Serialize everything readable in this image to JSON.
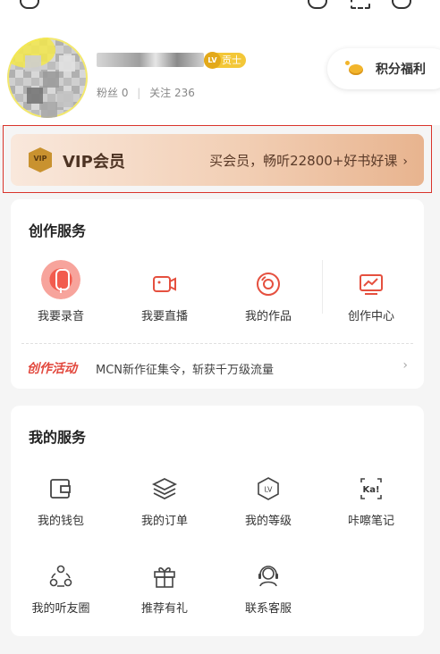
{
  "profile": {
    "level_badge_icon": "LV",
    "level_badge_text": "贡士",
    "fans_label": "粉丝 0",
    "stats_sep": "|",
    "follow_label": "关注 236",
    "points_button": "积分福利"
  },
  "vip": {
    "icon_text": "VIP",
    "title": "VIP会员",
    "promo": "买会员，畅听22800+好书好课",
    "arrow": "›"
  },
  "creation": {
    "title": "创作服务",
    "items": [
      {
        "label": "我要录音",
        "icon": "microphone-icon"
      },
      {
        "label": "我要直播",
        "icon": "video-camera-icon"
      },
      {
        "label": "我的作品",
        "icon": "disc-icon"
      },
      {
        "label": "创作中心",
        "icon": "chart-monitor-icon"
      }
    ],
    "activity_tag": "创作活动",
    "activity_text": "MCN新作征集令，斩获千万级流量",
    "activity_arrow": "›"
  },
  "my_services": {
    "title": "我的服务",
    "items": [
      {
        "label": "我的钱包",
        "icon": "wallet-icon"
      },
      {
        "label": "我的订单",
        "icon": "layers-icon"
      },
      {
        "label": "我的等级",
        "icon": "level-badge-icon"
      },
      {
        "label": "咔嚓笔记",
        "icon": "ka-note-icon"
      },
      {
        "label": "我的听友圈",
        "icon": "friends-circle-icon"
      },
      {
        "label": "推荐有礼",
        "icon": "gift-icon"
      },
      {
        "label": "联系客服",
        "icon": "headset-icon"
      }
    ],
    "ka_icon_text": "Ka!",
    "lv_icon_text": "LV"
  }
}
